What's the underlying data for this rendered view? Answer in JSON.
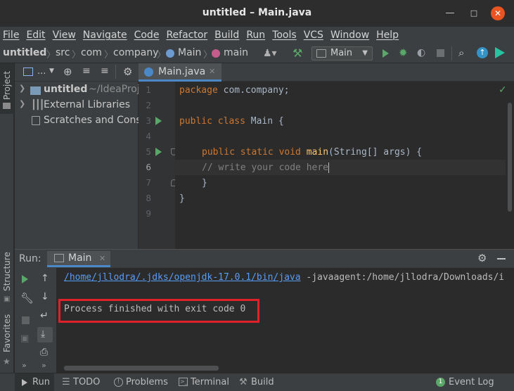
{
  "window": {
    "title": "untitled – Main.java",
    "controls": {
      "minimize": "—",
      "maximize": "□",
      "close": "✕"
    }
  },
  "menu": [
    "File",
    "Edit",
    "View",
    "Navigate",
    "Code",
    "Refactor",
    "Build",
    "Run",
    "Tools",
    "VCS",
    "Window",
    "Help"
  ],
  "breadcrumbs": [
    "untitled",
    "src",
    "com",
    "company",
    "Main",
    "main"
  ],
  "run_config": {
    "label": "Main"
  },
  "side_tabs": {
    "project": "Project",
    "structure": "Structure",
    "favorites": "Favorites"
  },
  "project_tree": {
    "header_dots": "...",
    "items": [
      {
        "label": "untitled",
        "suffix": "~/IdeaProj",
        "bold": true
      },
      {
        "label": "External Libraries"
      },
      {
        "label": "Scratches and Conso"
      }
    ]
  },
  "editor": {
    "tab_label": "Main.java",
    "line_numbers": [
      "1",
      "2",
      "3",
      "4",
      "5",
      "6",
      "7",
      "8",
      "9"
    ],
    "code": {
      "l1_kw": "package",
      "l1_rest": " com.company;",
      "l3_kw": "public class",
      "l3_rest": " Main {",
      "l5_kw": "public static void",
      "l5_fn": " main",
      "l5_rest": "(String[] args) {",
      "l6_comment": "// write your code here",
      "l7": "}",
      "l8": "}"
    }
  },
  "run_panel": {
    "label": "Run:",
    "tab_label": "Main",
    "console": {
      "java_path": "/home/jllodra/.jdks/openjdk-17.0.1/bin/java",
      "args": " -javaagent:/home/jllodra/Downloads/i",
      "exit_message": "Process finished with exit code 0"
    }
  },
  "bottom_tabs": {
    "run": "Run",
    "todo": "TODO",
    "problems": "Problems",
    "terminal": "Terminal",
    "build": "Build",
    "event_log": "Event Log",
    "event_log_badge": "1"
  },
  "colors": {
    "accent_blue": "#4a88c7",
    "run_green": "#59a869",
    "highlight_red": "#e0202a",
    "link_blue": "#589df6"
  }
}
